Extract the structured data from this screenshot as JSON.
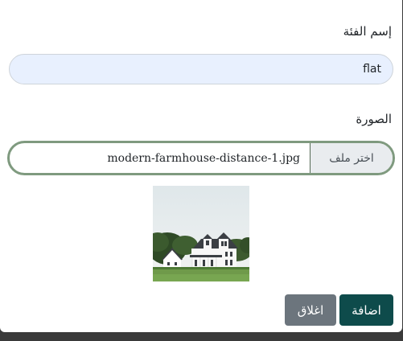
{
  "form": {
    "name_label": "إسم الفئة",
    "name_value": "flat",
    "image_label": "الصورة",
    "file_button_label": "اختر ملف",
    "file_name": "modern-farmhouse-distance-1.jpg"
  },
  "preview": {
    "image": "farmhouse-photo"
  },
  "actions": {
    "add_label": "اضافة",
    "close_label": "اغلاق"
  },
  "colors": {
    "primary": "#0e4b4b",
    "secondary": "#6c757d",
    "input_bg": "#e8f0fe",
    "focus_border": "#7f9a7f"
  }
}
